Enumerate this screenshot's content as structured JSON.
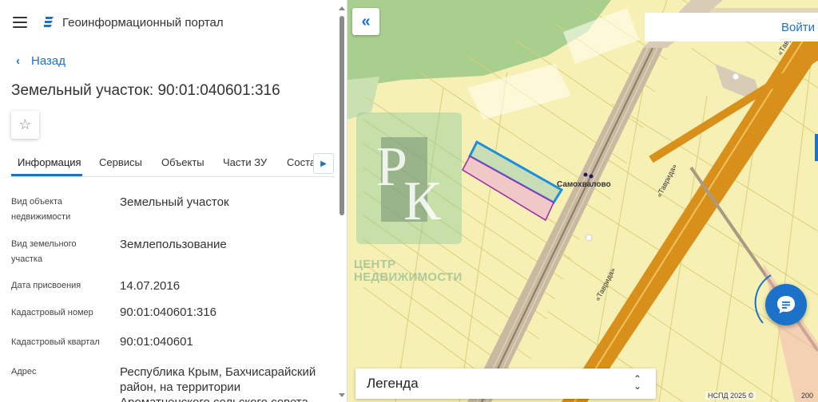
{
  "header": {
    "title": "Геоинформационный портал"
  },
  "nav": {
    "back_label": "Назад"
  },
  "parcel": {
    "title": "Земельный участок: 90:01:040601:316"
  },
  "tabs": [
    {
      "label": "Информация",
      "active": true
    },
    {
      "label": "Сервисы",
      "active": false
    },
    {
      "label": "Объекты",
      "active": false
    },
    {
      "label": "Части ЗУ",
      "active": false
    },
    {
      "label": "Соста",
      "active": false
    }
  ],
  "properties": [
    {
      "label": "Вид объекта недвижимости",
      "value": "Земельный участок"
    },
    {
      "label": "Вид земельного участка",
      "value": "Землепользование"
    },
    {
      "label": "Дата присвоения",
      "value": "14.07.2016"
    },
    {
      "label": "Кадастровый номер",
      "value": "90:01:040601:316"
    },
    {
      "label": "Кадастровый квартал",
      "value": "90:01:040601"
    },
    {
      "label": "Адрес",
      "value": "Республика Крым, Бахчисарайский район, на территории Ароматненского сельского совета"
    }
  ],
  "map": {
    "login_label": "Войти",
    "place_label": "Самохвалово",
    "road_label": "«Таврида»",
    "watermark_letters": "РК",
    "watermark_text": "ЦЕНТР НЕДВИЖИМОСТИ",
    "legend_label": "Легенда",
    "attribution": "НСПД 2025 ©",
    "scale": "200"
  },
  "icons": {
    "menu": "hamburger-icon",
    "logo": "portal-logo-icon",
    "back": "chevron-left-icon",
    "favorite": "star-outline-icon",
    "tabs_scroll": "caret-right-icon",
    "collapse": "double-chevron-left-icon",
    "chat": "chat-icon",
    "legend_toggle": "chevron-up-down-icon"
  },
  "colors": {
    "accent": "#1a73c8",
    "map_fill": "#f7f0b5",
    "selected_parcel": "#1a73c8",
    "neighbor_parcel": "#9b2aa8",
    "road": "#d9901a"
  }
}
